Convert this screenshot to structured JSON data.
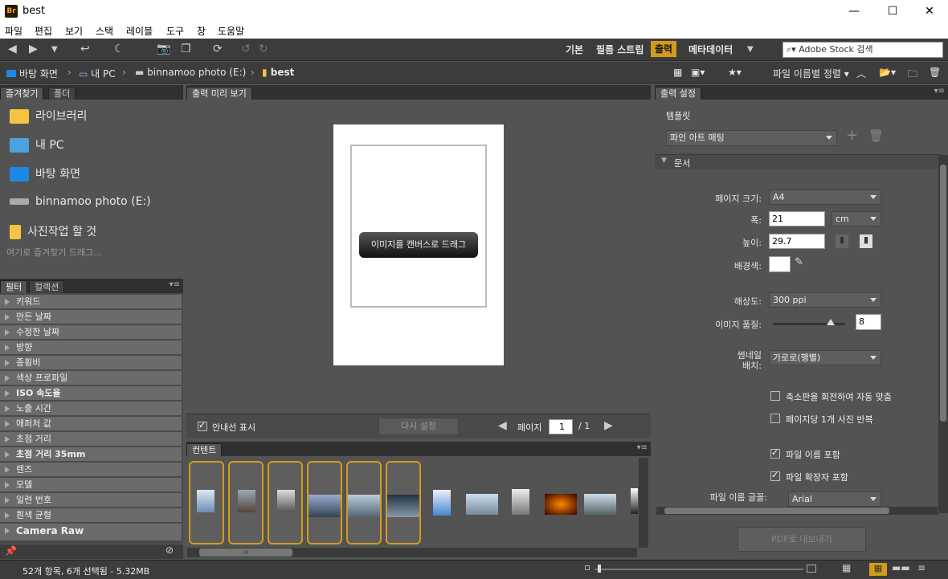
{
  "window": {
    "title": "best",
    "app_icon": "Br"
  },
  "menu": [
    "파일",
    "편집",
    "보기",
    "스택",
    "레이블",
    "도구",
    "창",
    "도움말"
  ],
  "workspaces": {
    "items": [
      "기본",
      "필름 스트립",
      "출력",
      "메타데이터"
    ],
    "active": "출력"
  },
  "search": {
    "placeholder": "Adobe Stock 검색"
  },
  "path": [
    "바탕 화면",
    "내 PC",
    "binnamoo photo (E:)",
    "best"
  ],
  "sort": {
    "label": "파일 이름별 정렬"
  },
  "favorites": {
    "tabs": [
      "즐겨찾기",
      "폴더"
    ],
    "items": [
      "라이브러리",
      "내 PC",
      "바탕 화면",
      "binnamoo photo (E:)",
      "사진작업 할 것"
    ],
    "hint": "여기로 즐겨찾기 드래그..."
  },
  "filter": {
    "tabs": [
      "필터",
      "컬렉션"
    ],
    "items": [
      "키워드",
      "만든 날짜",
      "수정한 날짜",
      "방향",
      "종횡비",
      "색상 프로파일",
      "ISO 속도율",
      "노출 시간",
      "애퍼처 값",
      "초점 거리",
      "초점 거리 35mm",
      "렌즈",
      "모델",
      "일련 번호",
      "흰색 균형",
      "Camera Raw"
    ]
  },
  "preview": {
    "tab": "출력 미리 보기",
    "drag_label": "이미지를 캔버스로 드래그",
    "guides_label": "안내선 표시",
    "reset_label": "다시 설정",
    "page_label": "페이지",
    "page_value": "1",
    "page_total": "/ 1"
  },
  "content": {
    "tab": "컨텐트",
    "scroll_mark": "III"
  },
  "output": {
    "tab": "출력 설정",
    "template_label": "템플릿",
    "template_value": "파인 아트 매팅",
    "section": "문서",
    "page_size_label": "페이지 크기:",
    "page_size_value": "A4",
    "width_label": "폭:",
    "width_value": "21",
    "unit_value": "cm",
    "height_label": "높이:",
    "height_value": "29.7",
    "bg_label": "배경색:",
    "resolution_label": "해상도:",
    "resolution_value": "300 ppi",
    "quality_label": "이미지 품질:",
    "quality_value": "8",
    "quality_fraction": 0.8,
    "thumb_label_1": "썸네일",
    "thumb_label_2": "배치:",
    "thumb_value": "가로로(행별)",
    "check1": "축소판을 회전하여 자동 맞춤",
    "check2": "페이지당 1개 사진 반복",
    "check3": "파일 이름 포함",
    "check4": "파일 확장자 포함",
    "font_label": "파일 이름 글꼴:",
    "font_value": "Arial",
    "export_label": "PDF로 내보내기"
  },
  "status": {
    "text": "52개 항목, 6개 선택됨 - 5.32MB"
  }
}
